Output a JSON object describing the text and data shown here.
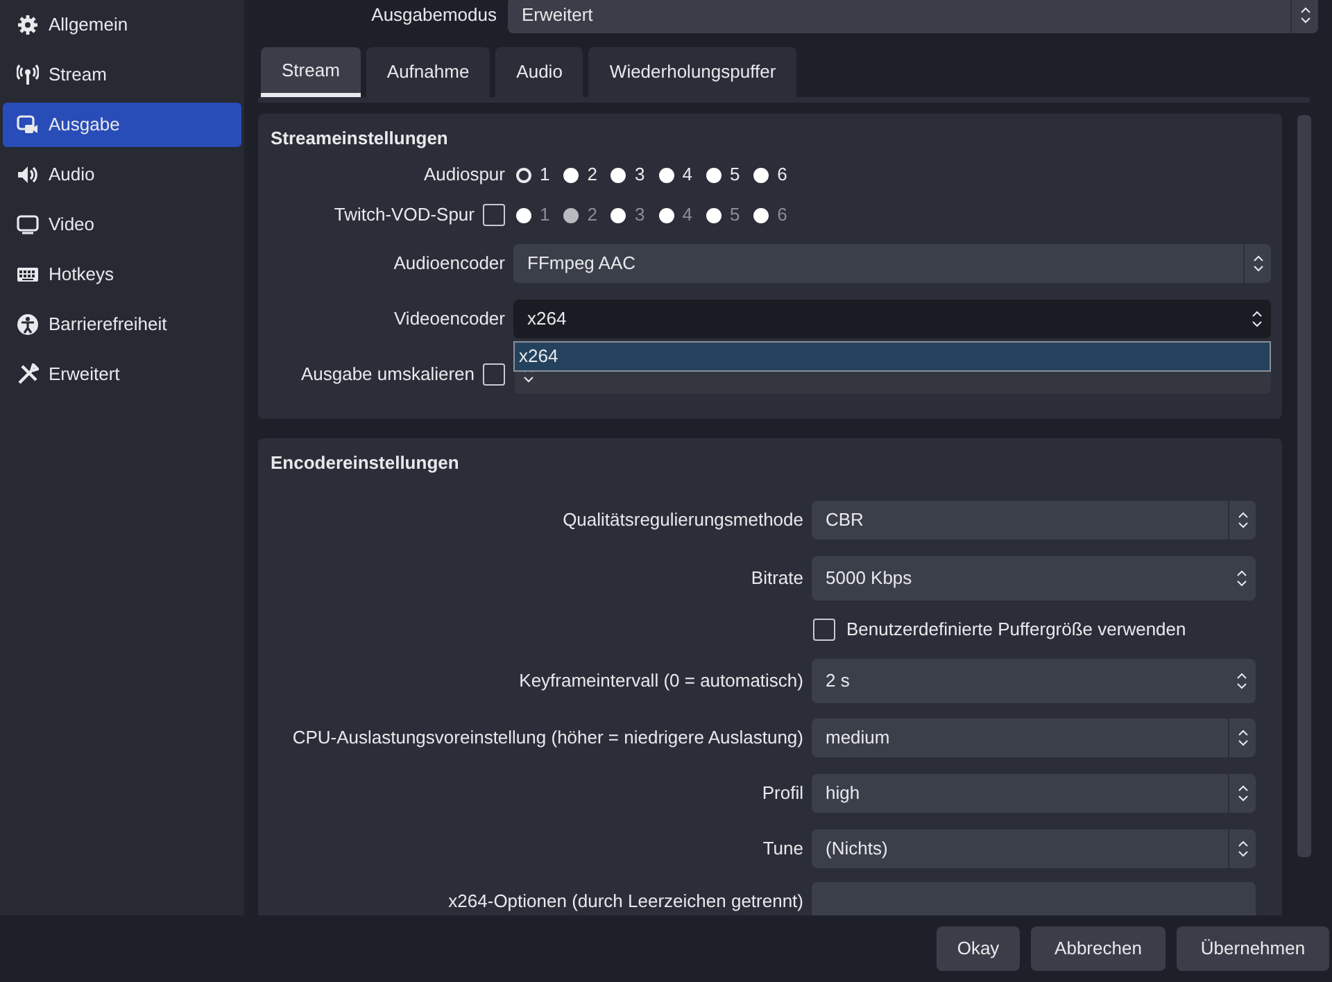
{
  "sidebar": {
    "items": [
      {
        "label": "Allgemein",
        "selected": false
      },
      {
        "label": "Stream",
        "selected": false
      },
      {
        "label": "Ausgabe",
        "selected": true
      },
      {
        "label": "Audio",
        "selected": false
      },
      {
        "label": "Video",
        "selected": false
      },
      {
        "label": "Hotkeys",
        "selected": false
      },
      {
        "label": "Barrierefreiheit",
        "selected": false
      },
      {
        "label": "Erweitert",
        "selected": false
      }
    ]
  },
  "output_mode": {
    "label": "Ausgabemodus",
    "value": "Erweitert"
  },
  "tabs": [
    {
      "label": "Stream",
      "selected": true
    },
    {
      "label": "Aufnahme",
      "selected": false
    },
    {
      "label": "Audio",
      "selected": false
    },
    {
      "label": "Wiederholungspuffer",
      "selected": false
    }
  ],
  "stream_settings": {
    "title": "Streameinstellungen",
    "rows": [
      {
        "kind": "radios",
        "label": "Audiospur",
        "disabled": false,
        "options": [
          {
            "label": "1",
            "selected": true
          },
          {
            "label": "2",
            "selected": false
          },
          {
            "label": "3",
            "selected": false
          },
          {
            "label": "4",
            "selected": false
          },
          {
            "label": "5",
            "selected": false
          },
          {
            "label": "6",
            "selected": false
          }
        ]
      },
      {
        "kind": "radios",
        "label": "Twitch-VOD-Spur",
        "checked": false,
        "disabled": true,
        "options": [
          {
            "label": "1",
            "selected": false
          },
          {
            "label": "2",
            "selected": true
          },
          {
            "label": "3",
            "selected": false
          },
          {
            "label": "4",
            "selected": false
          },
          {
            "label": "5",
            "selected": false
          },
          {
            "label": "6",
            "selected": false
          }
        ]
      },
      {
        "kind": "combo",
        "label": "Audioencoder",
        "value": "FFmpeg AAC"
      },
      {
        "kind": "combo",
        "label": "Videoencoder",
        "value": "x264",
        "open": true,
        "popup_items": [
          {
            "label": "x264",
            "selected": true
          }
        ]
      },
      {
        "kind": "combo",
        "label": "Ausgabe umskalieren",
        "checked": false,
        "disabled": true
      }
    ]
  },
  "encoder_settings": {
    "title": "Encodereinstellungen",
    "rows": [
      {
        "kind": "combo",
        "label": "Qualitätsregulierungsmethode",
        "value": "CBR"
      },
      {
        "kind": "spin",
        "label": "Bitrate",
        "value": "5000 Kbps"
      },
      {
        "kind": "check",
        "label": "Benutzerdefinierte Puffergröße verwenden",
        "checked": false
      },
      {
        "kind": "spin",
        "label": "Keyframeintervall (0 = automatisch)",
        "value": "2 s"
      },
      {
        "kind": "combo",
        "label": "CPU-Auslastungsvoreinstellung (höher = niedrigere Auslastung)",
        "value": "medium"
      },
      {
        "kind": "combo",
        "label": "Profil",
        "value": "high"
      },
      {
        "kind": "combo",
        "label": "Tune",
        "value": "(Nichts)"
      },
      {
        "kind": "text",
        "label": "x264-Optionen (durch Leerzeichen getrennt)"
      }
    ]
  },
  "buttons": [
    "Okay",
    "Abbrechen",
    "Übernehmen"
  ]
}
